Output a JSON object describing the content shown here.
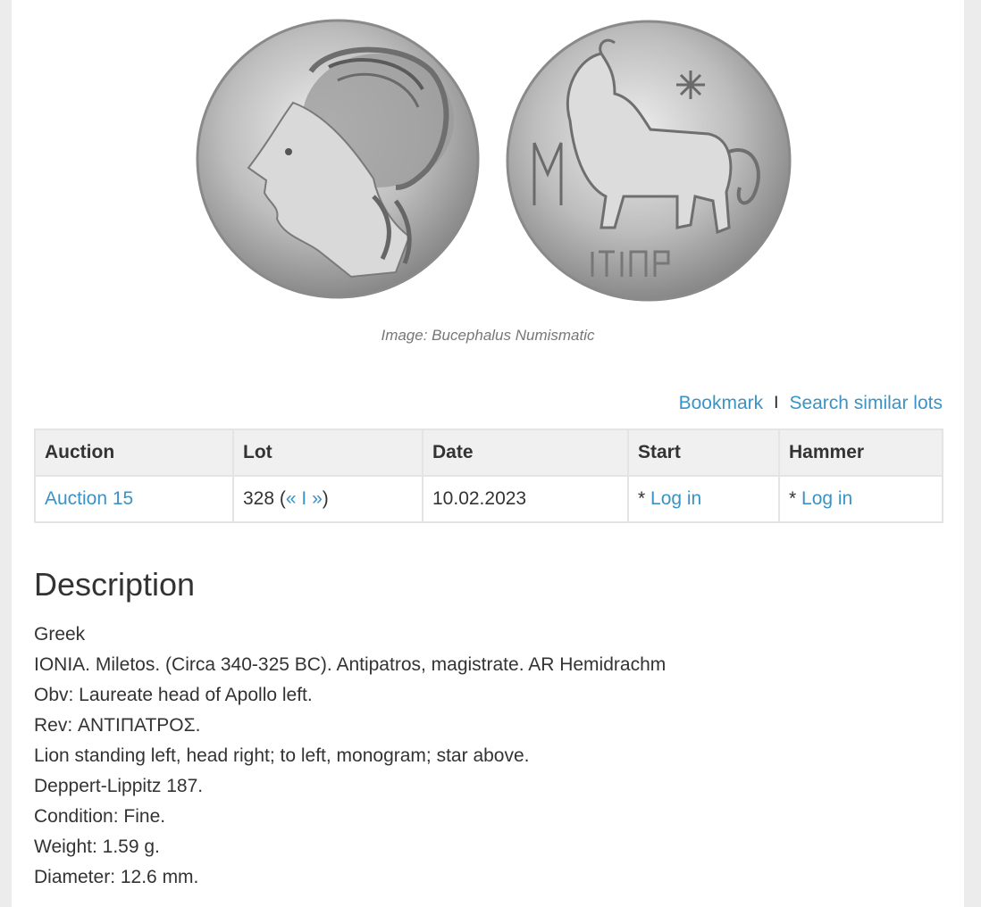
{
  "image": {
    "obverse_icon": "coin-obverse-apollo-head",
    "reverse_icon": "coin-reverse-lion-star",
    "caption": "Image: Bucephalus Numismatic"
  },
  "actions": {
    "bookmark": "Bookmark",
    "separator": "I",
    "search_similar": "Search similar lots"
  },
  "table": {
    "headers": [
      "Auction",
      "Lot",
      "Date",
      "Start",
      "Hammer"
    ],
    "row": {
      "auction": "Auction 15",
      "lot_number": "328 (",
      "lot_prev": "«",
      "lot_sep": " I ",
      "lot_next": "»",
      "lot_close": ")",
      "date": "10.02.2023",
      "start_prefix": "* ",
      "start_link": "Log in",
      "hammer_prefix": "* ",
      "hammer_link": "Log in"
    }
  },
  "description": {
    "title": "Description",
    "lines": [
      "Greek",
      "IONIA. Miletos. (Circa 340-325 BC). Antipatros, magistrate. AR Hemidrachm",
      "Obv: Laureate head of Apollo left.",
      "Rev: ΑΝΤΙΠΑΤΡΟΣ.",
      "Lion standing left, head right; to left, monogram; star above.",
      "Deppert-Lippitz 187.",
      "Condition: Fine.",
      "Weight: 1.59 g.",
      "Diameter: 12.6 mm."
    ]
  }
}
